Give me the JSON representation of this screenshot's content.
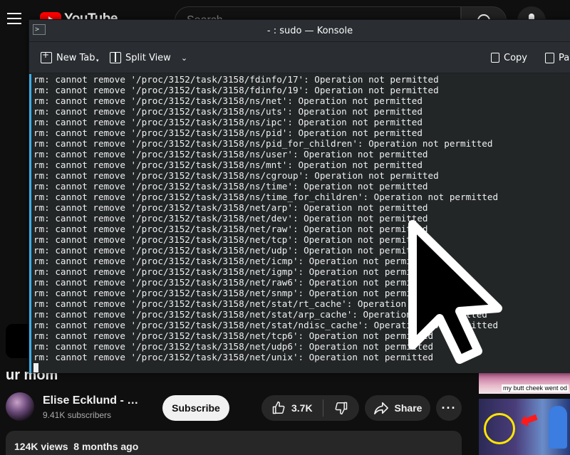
{
  "youtube": {
    "logo_text": "YouTube",
    "search_placeholder": "Search",
    "video_title": "ur mom",
    "channel_name": "Elise Ecklund - To...",
    "subscriber_count": "9.41K subscribers",
    "subscribe_label": "Subscribe",
    "like_count": "3.7K",
    "share_label": "Share",
    "more_label": "···",
    "description_meta": "124K views  8 months ago",
    "sidebar_thumb_caption": "my butt cheek went od"
  },
  "konsole": {
    "window_title": "- : sudo — Konsole",
    "toolbar": {
      "new_tab": "New Tab",
      "split_view": "Split View",
      "copy": "Copy",
      "paste": "Pa"
    },
    "lines": [
      "rm: cannot remove '/proc/3152/task/3158/fdinfo/17': Operation not permitted",
      "rm: cannot remove '/proc/3152/task/3158/fdinfo/19': Operation not permitted",
      "rm: cannot remove '/proc/3152/task/3158/ns/net': Operation not permitted",
      "rm: cannot remove '/proc/3152/task/3158/ns/uts': Operation not permitted",
      "rm: cannot remove '/proc/3152/task/3158/ns/ipc': Operation not permitted",
      "rm: cannot remove '/proc/3152/task/3158/ns/pid': Operation not permitted",
      "rm: cannot remove '/proc/3152/task/3158/ns/pid_for_children': Operation not permitted",
      "rm: cannot remove '/proc/3152/task/3158/ns/user': Operation not permitted",
      "rm: cannot remove '/proc/3152/task/3158/ns/mnt': Operation not permitted",
      "rm: cannot remove '/proc/3152/task/3158/ns/cgroup': Operation not permitted",
      "rm: cannot remove '/proc/3152/task/3158/ns/time': Operation not permitted",
      "rm: cannot remove '/proc/3152/task/3158/ns/time_for_children': Operation not permitted",
      "rm: cannot remove '/proc/3152/task/3158/net/arp': Operation not permitted",
      "rm: cannot remove '/proc/3152/task/3158/net/dev': Operation not permitted",
      "rm: cannot remove '/proc/3152/task/3158/net/raw': Operation not permitted",
      "rm: cannot remove '/proc/3152/task/3158/net/tcp': Operation not permitted",
      "rm: cannot remove '/proc/3152/task/3158/net/udp': Operation not permitted",
      "rm: cannot remove '/proc/3152/task/3158/net/icmp': Operation not permitted",
      "rm: cannot remove '/proc/3152/task/3158/net/igmp': Operation not permitted",
      "rm: cannot remove '/proc/3152/task/3158/net/raw6': Operation not permitted",
      "rm: cannot remove '/proc/3152/task/3158/net/snmp': Operation not permitted",
      "rm: cannot remove '/proc/3152/task/3158/net/stat/rt_cache': Operation not permitted",
      "rm: cannot remove '/proc/3152/task/3158/net/stat/arp_cache': Operation not permitted",
      "rm: cannot remove '/proc/3152/task/3158/net/stat/ndisc_cache': Operation not permitted",
      "rm: cannot remove '/proc/3152/task/3158/net/tcp6': Operation not permitted",
      "rm: cannot remove '/proc/3152/task/3158/net/udp6': Operation not permitted",
      "rm: cannot remove '/proc/3152/task/3158/net/unix': Operation not permitted"
    ]
  },
  "colors": {
    "youtube_bg": "#0f0f0f",
    "youtube_red": "#ff0000",
    "konsole_bg": "#232627",
    "konsole_focus_accent": "#3daee9",
    "terminal_text": "#eff0f1"
  },
  "icons": {
    "menu": "hamburger-menu-icon",
    "search": "search-icon",
    "mic": "microphone-icon",
    "like": "thumbs-up-icon",
    "dislike": "thumbs-down-icon",
    "share": "share-arrow-icon",
    "new_tab": "new-tab-icon",
    "split_view": "split-view-icon",
    "copy": "copy-icon",
    "paste": "paste-icon",
    "pointer": "mouse-pointer-icon"
  }
}
